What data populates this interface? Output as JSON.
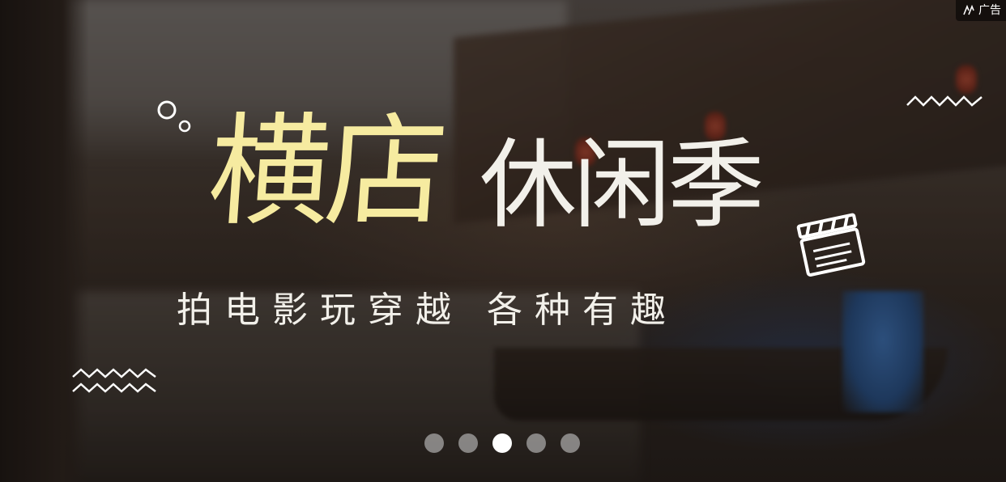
{
  "banner": {
    "title_main": "横店",
    "title_sub": "休闲季",
    "tagline": "拍电影玩穿越 各种有趣"
  },
  "ad_badge": {
    "icon": "ad-logo-icon",
    "label": "广告"
  },
  "colors": {
    "title_main": "#f6eba0",
    "title_sub": "#f2f0ea",
    "dot_active": "#ffffff",
    "dot_inactive": "#c8c8c8"
  },
  "carousel": {
    "slide_count": 5,
    "active_index": 2
  },
  "decorations": [
    "circles-icon",
    "zigzag-icon",
    "clapperboard-icon"
  ]
}
